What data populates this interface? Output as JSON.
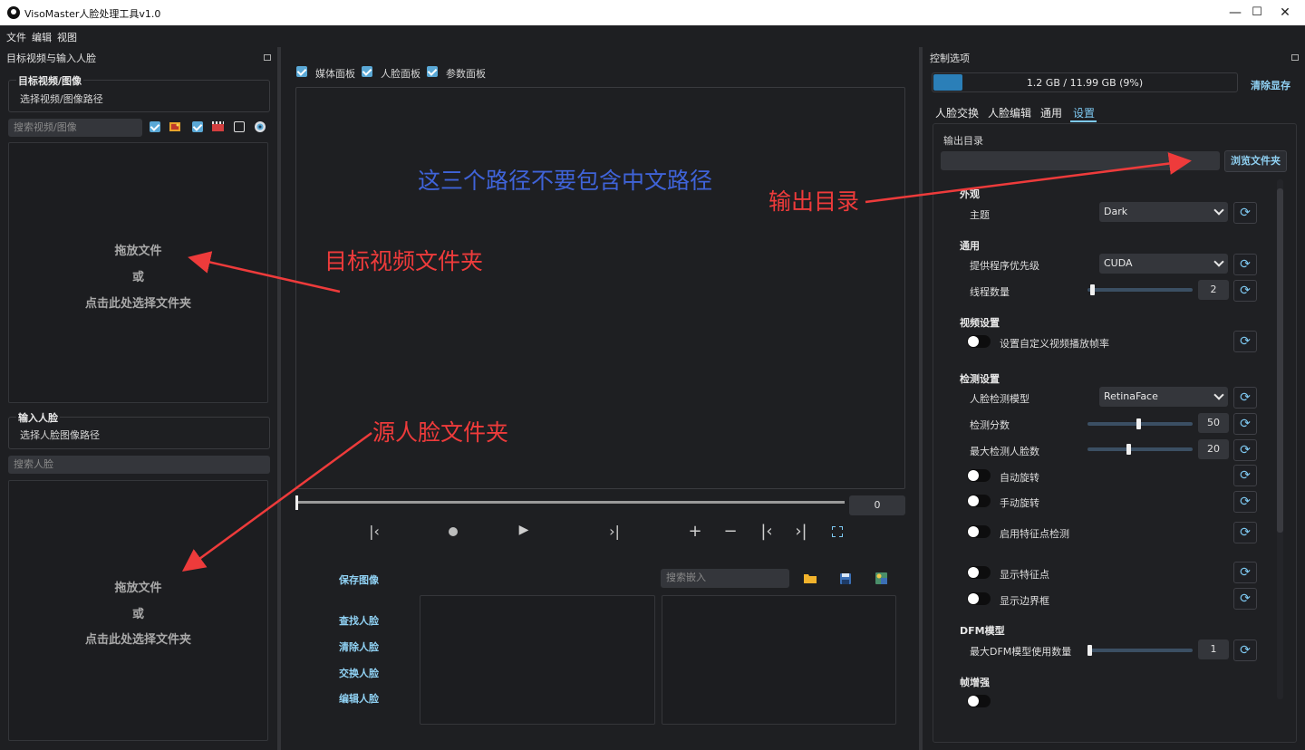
{
  "window": {
    "title": "VisoMaster人脸处理工具v1.0",
    "controls": [
      "—",
      "☐",
      "✕"
    ]
  },
  "menu": [
    "文件",
    "编辑",
    "视图"
  ],
  "left_panel": {
    "title": "目标视频与输入人脸",
    "target_group": {
      "label": "目标视频/图像",
      "path_text": "选择视频/图像路径"
    },
    "search_media_placeholder": "搜索视频/图像",
    "filters": [
      {
        "name": "filter-images",
        "checked": true
      },
      {
        "name": "filter-videos",
        "checked": true
      },
      {
        "name": "filter-webcam",
        "checked": false
      }
    ],
    "drop1": {
      "line1": "拖放文件",
      "line2": "或",
      "line3": "点击此处选择文件夹"
    },
    "source_group": {
      "label": "输入人脸",
      "path_text": "选择人脸图像路径"
    },
    "search_face_placeholder": "搜索人脸",
    "drop2": {
      "line1": "拖放文件",
      "line2": "或",
      "line3": "点击此处选择文件夹"
    }
  },
  "center_panel": {
    "panels": [
      "媒体面板",
      "人脸面板",
      "参数面板"
    ],
    "frame_value": "0",
    "save_image": "保存图像",
    "embed_search_placeholder": "搜索嵌入",
    "face_actions": [
      "查找人脸",
      "清除人脸",
      "交换人脸",
      "编辑人脸"
    ]
  },
  "right_panel": {
    "title": "控制选项",
    "vram": {
      "text": "1.2 GB / 11.99 GB (9%)",
      "percent": 9,
      "clear_label": "清除显存"
    },
    "tabs": [
      "人脸交换",
      "人脸编辑",
      "通用",
      "设置"
    ],
    "active_tab": 3,
    "output_dir_label": "输出目录",
    "browse_label": "浏览文件夹",
    "sections": {
      "appearance": "外观",
      "general": "通用",
      "video": "视频设置",
      "detect": "检测设置",
      "dfm": "DFM模型",
      "frame_enhance": "帧增强"
    },
    "theme": {
      "label": "主题",
      "value": "Dark"
    },
    "provider": {
      "label": "提供程序优先级",
      "value": "CUDA"
    },
    "threads": {
      "label": "线程数量",
      "value": "2"
    },
    "custom_fps": {
      "label": "设置自定义视频播放帧率"
    },
    "detect_model": {
      "label": "人脸检测模型",
      "value": "RetinaFace"
    },
    "detect_score": {
      "label": "检测分数",
      "value": "50"
    },
    "max_faces": {
      "label": "最大检测人脸数",
      "value": "20"
    },
    "auto_rotate": {
      "label": "自动旋转"
    },
    "manual_rotate": {
      "label": "手动旋转"
    },
    "landmark_detect": {
      "label": "启用特征点检测"
    },
    "show_landmarks": {
      "label": "显示特征点"
    },
    "show_bbox": {
      "label": "显示边界框"
    },
    "max_dfm": {
      "label": "最大DFM模型使用数量",
      "value": "1"
    }
  },
  "annotations": {
    "note": "这三个路径不要包含中文路径",
    "output_dir": "输出目录",
    "target_folder": "目标视频文件夹",
    "source_folder": "源人脸文件夹"
  },
  "colors": {
    "accent": "#7ec9f2",
    "annotation_red": "#ee3b3b",
    "annotation_blue": "#3f63d8",
    "background": "#1e1f22"
  }
}
